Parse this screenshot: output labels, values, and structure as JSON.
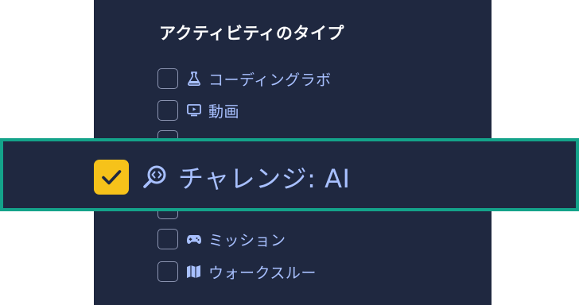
{
  "filter": {
    "heading": "アクティビティのタイプ",
    "items": [
      {
        "label": "コーディングラボ",
        "icon": "flask-icon",
        "checked": false
      },
      {
        "label": "動画",
        "icon": "video-icon",
        "checked": false
      },
      {
        "label": "チャレンジ: AI",
        "icon": "magnifier-code-icon",
        "checked": true
      },
      {
        "label": "ミッション",
        "icon": "gamepad-icon",
        "checked": false
      },
      {
        "label": "ウォークスルー",
        "icon": "map-icon",
        "checked": false
      }
    ]
  },
  "colors": {
    "panel_bg": "#1f2840",
    "label": "#a8c0ff",
    "checked_box": "#f6c21a",
    "highlight_border": "#14a38a"
  }
}
